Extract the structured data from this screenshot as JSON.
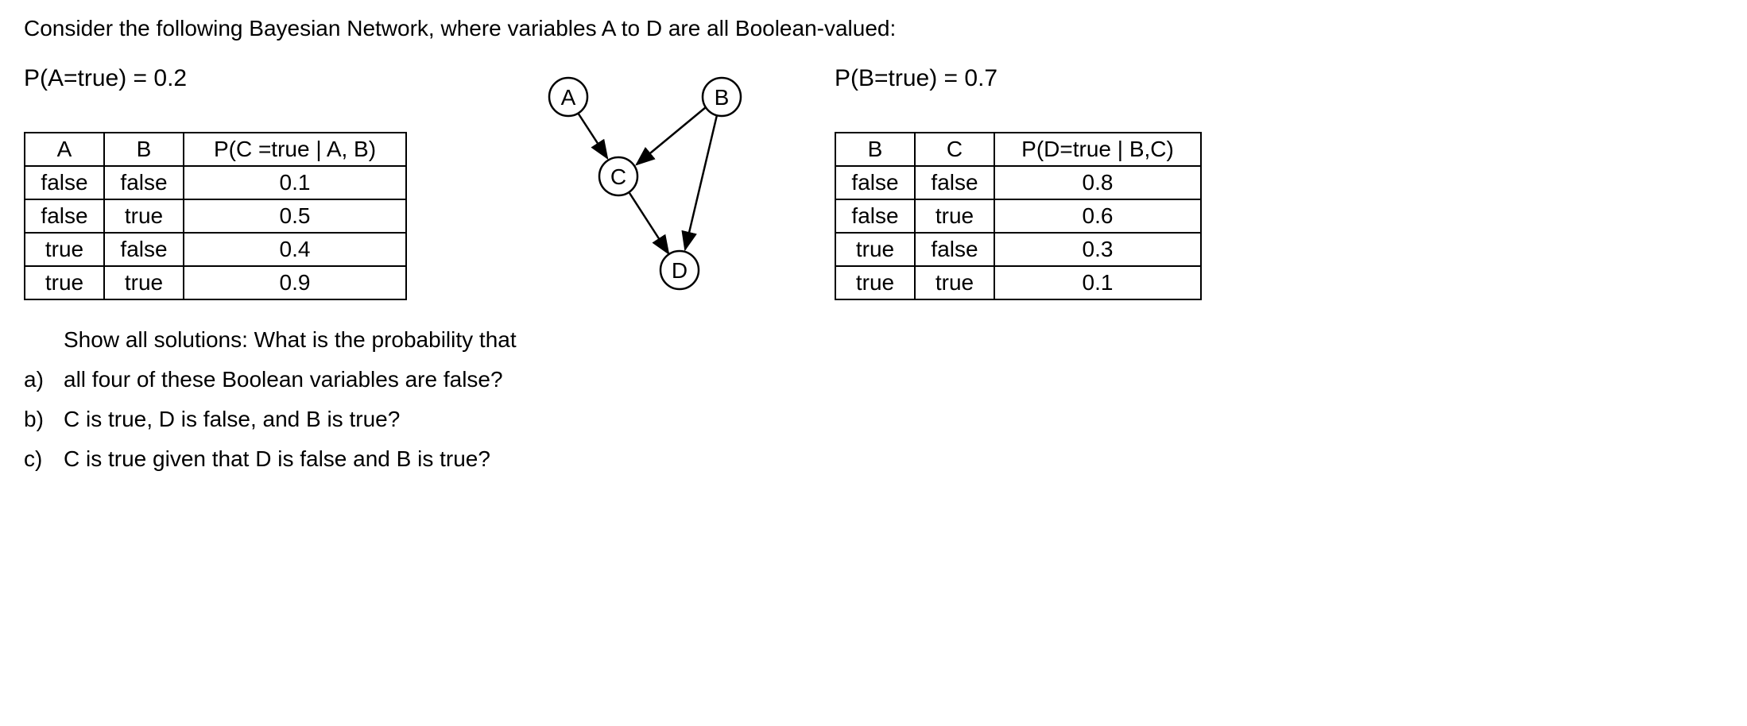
{
  "intro": "Consider the following Bayesian Network, where variables A to D are all Boolean-valued:",
  "priors": {
    "A": "P(A=true) = 0.2",
    "B": "P(B=true) = 0.7"
  },
  "graph": {
    "nodes": [
      "A",
      "B",
      "C",
      "D"
    ],
    "edges": [
      [
        "A",
        "C"
      ],
      [
        "B",
        "C"
      ],
      [
        "B",
        "D"
      ],
      [
        "C",
        "D"
      ]
    ]
  },
  "cpt_c": {
    "headers": [
      "A",
      "B",
      "P(C =true | A, B)"
    ],
    "rows": [
      [
        "false",
        "false",
        "0.1"
      ],
      [
        "false",
        "true",
        "0.5"
      ],
      [
        "true",
        "false",
        "0.4"
      ],
      [
        "true",
        "true",
        "0.9"
      ]
    ]
  },
  "cpt_d": {
    "headers": [
      "B",
      "C",
      "P(D=true | B,C)"
    ],
    "rows": [
      [
        "false",
        "false",
        "0.8"
      ],
      [
        "false",
        "true",
        "0.6"
      ],
      [
        "true",
        "false",
        "0.3"
      ],
      [
        "true",
        "true",
        "0.1"
      ]
    ]
  },
  "question_prompt": "Show all solutions: What is the probability that",
  "questions": {
    "a": {
      "letter": "a)",
      "text": "all four of these Boolean variables are false?"
    },
    "b": {
      "letter": "b)",
      "text": "C is true, D is false, and B is true?"
    },
    "c": {
      "letter": "c)",
      "text": "C is true given that D is false and B is true?"
    }
  }
}
